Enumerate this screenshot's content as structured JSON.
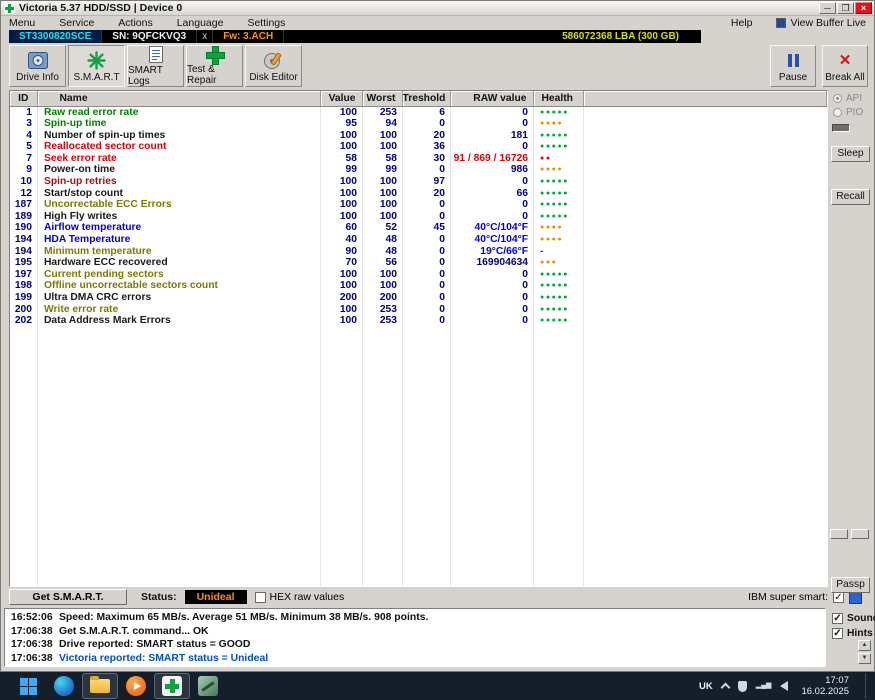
{
  "window": {
    "title": "Victoria 5.37 HDD/SSD | Device 0"
  },
  "menubar": {
    "items": [
      "Menu",
      "Service",
      "Actions",
      "Language",
      "Settings"
    ],
    "help": "Help",
    "view_buffer_live": "View Buffer Live"
  },
  "drive_tab": {
    "model": "ST3300820SCE",
    "serial": "SN: 9QFCKVQ3",
    "close": "x",
    "firmware": "Fw: 3.ACH",
    "capacity": "586072368 LBA (300 GB)"
  },
  "toolbar": {
    "drive_info": "Drive Info",
    "smart": "S.M.A.R.T",
    "smart_logs": "SMART Logs",
    "test_repair": "Test & Repair",
    "disk_editor": "Disk Editor",
    "pause": "Pause",
    "break_all": "Break All"
  },
  "right_panel": {
    "api": "API",
    "pio": "PIO",
    "sleep": "Sleep",
    "recall": "Recall",
    "passp": "Passp"
  },
  "smart_table": {
    "headers": {
      "id": "ID",
      "name": "Name",
      "value": "Value",
      "worst": "Worst",
      "treshold": "Treshold",
      "raw": "RAW value",
      "health": "Health"
    },
    "rows": [
      {
        "id": "1",
        "name": "Raw read error rate",
        "value": "100",
        "worst": "253",
        "treshold": "6",
        "raw": "0",
        "name_color": "green",
        "raw_color": "navy",
        "health_dots": 5,
        "health_color": "green",
        "health_text": ""
      },
      {
        "id": "3",
        "name": "Spin-up time",
        "value": "95",
        "worst": "94",
        "treshold": "0",
        "raw": "0",
        "name_color": "green",
        "raw_color": "navy",
        "health_dots": 4,
        "health_color": "orange",
        "health_text": ""
      },
      {
        "id": "4",
        "name": "Number of spin-up times",
        "value": "100",
        "worst": "100",
        "treshold": "20",
        "raw": "181",
        "name_color": "black",
        "raw_color": "navy",
        "health_dots": 5,
        "health_color": "green",
        "health_text": ""
      },
      {
        "id": "5",
        "name": "Reallocated sector count",
        "value": "100",
        "worst": "100",
        "treshold": "36",
        "raw": "0",
        "name_color": "red",
        "raw_color": "navy",
        "health_dots": 5,
        "health_color": "green",
        "health_text": ""
      },
      {
        "id": "7",
        "name": "Seek error rate",
        "value": "58",
        "worst": "58",
        "treshold": "30",
        "raw": "91 / 869 / 16726",
        "name_color": "red",
        "raw_color": "red",
        "health_dots": 2,
        "health_color": "red",
        "health_text": ""
      },
      {
        "id": "9",
        "name": "Power-on time",
        "value": "99",
        "worst": "99",
        "treshold": "0",
        "raw": "986",
        "name_color": "black",
        "raw_color": "navy",
        "health_dots": 4,
        "health_color": "orange",
        "health_text": ""
      },
      {
        "id": "10",
        "name": "Spin-up retries",
        "value": "100",
        "worst": "100",
        "treshold": "97",
        "raw": "0",
        "name_color": "maroon",
        "raw_color": "navy",
        "health_dots": 5,
        "health_color": "green",
        "health_text": ""
      },
      {
        "id": "12",
        "name": "Start/stop count",
        "value": "100",
        "worst": "100",
        "treshold": "20",
        "raw": "66",
        "name_color": "black",
        "raw_color": "navy",
        "health_dots": 5,
        "health_color": "green",
        "health_text": ""
      },
      {
        "id": "187",
        "name": "Uncorrectable ECC Errors",
        "value": "100",
        "worst": "100",
        "treshold": "0",
        "raw": "0",
        "name_color": "olive",
        "raw_color": "navy",
        "health_dots": 5,
        "health_color": "green",
        "health_text": ""
      },
      {
        "id": "189",
        "name": "High Fly writes",
        "value": "100",
        "worst": "100",
        "treshold": "0",
        "raw": "0",
        "name_color": "black",
        "raw_color": "navy",
        "health_dots": 5,
        "health_color": "green",
        "health_text": ""
      },
      {
        "id": "190",
        "name": "Airflow temperature",
        "value": "60",
        "worst": "52",
        "treshold": "45",
        "raw": "40°C/104°F",
        "name_color": "blue",
        "raw_color": "blue",
        "health_dots": 4,
        "health_color": "orange",
        "health_text": ""
      },
      {
        "id": "194",
        "name": "HDA Temperature",
        "value": "40",
        "worst": "48",
        "treshold": "0",
        "raw": "40°C/104°F",
        "name_color": "blue",
        "raw_color": "blue",
        "health_dots": 4,
        "health_color": "orange",
        "health_text": ""
      },
      {
        "id": "194",
        "name": "Minimum temperature",
        "value": "90",
        "worst": "48",
        "treshold": "0",
        "raw": "19°C/66°F",
        "name_color": "olive",
        "raw_color": "blue",
        "health_dots": 0,
        "health_color": "",
        "health_text": "-"
      },
      {
        "id": "195",
        "name": "Hardware ECC recovered",
        "value": "70",
        "worst": "56",
        "treshold": "0",
        "raw": "169904634",
        "name_color": "black",
        "raw_color": "navy",
        "health_dots": 3,
        "health_color": "orange",
        "health_text": ""
      },
      {
        "id": "197",
        "name": "Current pending sectors",
        "value": "100",
        "worst": "100",
        "treshold": "0",
        "raw": "0",
        "name_color": "olive",
        "raw_color": "navy",
        "health_dots": 5,
        "health_color": "green",
        "health_text": ""
      },
      {
        "id": "198",
        "name": "Offline uncorrectable sectors count",
        "value": "100",
        "worst": "100",
        "treshold": "0",
        "raw": "0",
        "name_color": "olive",
        "raw_color": "navy",
        "health_dots": 5,
        "health_color": "green",
        "health_text": ""
      },
      {
        "id": "199",
        "name": "Ultra DMA CRC errors",
        "value": "200",
        "worst": "200",
        "treshold": "0",
        "raw": "0",
        "name_color": "black",
        "raw_color": "navy",
        "health_dots": 5,
        "health_color": "green",
        "health_text": ""
      },
      {
        "id": "200",
        "name": "Write error rate",
        "value": "100",
        "worst": "253",
        "treshold": "0",
        "raw": "0",
        "name_color": "olive",
        "raw_color": "navy",
        "health_dots": 5,
        "health_color": "green",
        "health_text": ""
      },
      {
        "id": "202",
        "name": "Data Address Mark Errors",
        "value": "100",
        "worst": "253",
        "treshold": "0",
        "raw": "0",
        "name_color": "black",
        "raw_color": "navy",
        "health_dots": 5,
        "health_color": "green",
        "health_text": ""
      }
    ]
  },
  "status_bar": {
    "get_smart": "Get S.M.A.R.T.",
    "status_label": "Status:",
    "status_value": "Unideal",
    "hex_raw": "HEX raw values",
    "ibm_super_smart": "IBM super smart:"
  },
  "log": {
    "lines": [
      {
        "time": "16:52:06",
        "text": "Speed: Maximum 65 MB/s. Average 51 MB/s. Minimum 38 MB/s. 908 points.",
        "color": "black"
      },
      {
        "time": "17:06:38",
        "text": "Get S.M.A.R.T. command... OK",
        "color": "black"
      },
      {
        "time": "17:06:38",
        "text": "Drive reported: SMART status = GOOD",
        "color": "black"
      },
      {
        "time": "17:06:38",
        "text": "Victoria reported: SMART status = Unideal",
        "color": "blue"
      }
    ],
    "sound": "Sound",
    "hints": "Hints"
  },
  "taskbar": {
    "language": "UK",
    "time": "17:07",
    "date": "16.02.2025"
  },
  "colors": {
    "health_green": "#00a83c",
    "health_orange": "#e39000",
    "health_red": "#e80000",
    "value_navy": "#000080",
    "status_badge_bg": "#000000",
    "status_badge_text": "#ff8c00"
  }
}
